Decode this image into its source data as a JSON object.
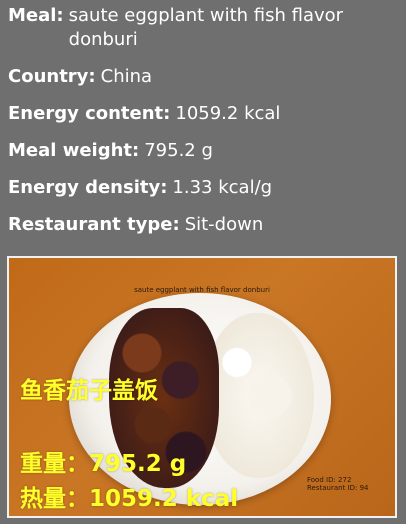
{
  "info": {
    "meal_label": "Meal:",
    "meal_value": "saute eggplant with fish flavor donburi",
    "country_label": "Country:",
    "country_value": "China",
    "energy_label": "Energy content:",
    "energy_value": "1059.2 kcal",
    "weight_label": "Meal weight:",
    "weight_value": "795.2 g",
    "density_label": "Energy density:",
    "density_value": "1.33 kcal/g",
    "restaurant_label": "Restaurant type:",
    "restaurant_value": "Sit-down"
  },
  "photo": {
    "title_en": "saute eggplant with fish flavor donburi",
    "title_cn": "鱼香茄子盖饭",
    "food_id": "Food ID: 272",
    "restaurant_id": "Restaurant ID: 94",
    "overlay_name": "鱼香茄子盖饭",
    "overlay_weight": "重量：795.2 g",
    "overlay_energy": "热量：1059.2 kcal",
    "overlay_color": "#ffff2a"
  }
}
